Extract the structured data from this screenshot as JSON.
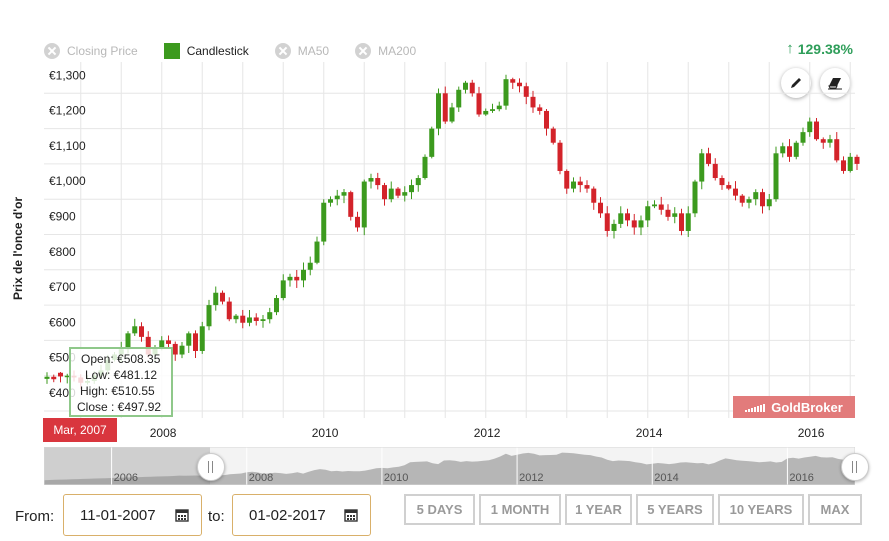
{
  "legend": [
    {
      "label": "Closing Price",
      "state": "off",
      "icon": "x-circle-icon"
    },
    {
      "label": "Candlestick",
      "state": "on",
      "icon": "square-icon",
      "color": "#3c9a1e"
    },
    {
      "label": "MA50",
      "state": "off",
      "icon": "x-circle-icon"
    },
    {
      "label": "MA200",
      "state": "off",
      "icon": "x-circle-icon"
    }
  ],
  "performance": {
    "arrow": "↑",
    "value": "129.38%",
    "color": "#2f9e5a"
  },
  "tools": {
    "draw": "pencil-icon",
    "erase": "eraser-icon"
  },
  "tooltip": {
    "open": "Open: €508.35",
    "low": "Low: €481.12",
    "high": "High: €510.55",
    "close": "Close : €497.92"
  },
  "date_flag": "Mar, 2007",
  "brand": "GoldBroker",
  "controls": {
    "from_label": "From:",
    "from_value": "11-01-2007",
    "to_label": "to:",
    "to_value": "01-02-2017",
    "ranges": [
      "5 DAYS",
      "1 MONTH",
      "1 YEAR",
      "5 YEARS",
      "10 YEARS",
      "MAX"
    ]
  },
  "colors": {
    "up": "#3c9a1e",
    "down": "#d3232a",
    "grid": "#e6e6e6"
  },
  "chart_data": {
    "type": "candlestick",
    "title": "",
    "xlabel": "",
    "ylabel": "Prix de l'once d'or",
    "ylim": [
      400,
      1380
    ],
    "yticks": [
      400,
      500,
      600,
      700,
      800,
      900,
      1000,
      1100,
      1200,
      1300
    ],
    "ytick_labels": [
      "€400",
      "€500",
      "€600",
      "€700",
      "€800",
      "€900",
      "€1,000",
      "€1,100",
      "€1,200",
      "€1,300"
    ],
    "xticks": [
      "2008",
      "2010",
      "2012",
      "2014",
      "2016"
    ],
    "navigator_ticks": [
      "2006",
      "2008",
      "2010",
      "2012",
      "2014",
      "2016"
    ],
    "start": "2007-01",
    "closes": [
      497,
      490,
      498,
      500,
      495,
      480,
      485,
      500,
      515,
      545,
      560,
      575,
      620,
      640,
      610,
      560,
      580,
      600,
      590,
      560,
      585,
      620,
      570,
      640,
      700,
      735,
      710,
      660,
      670,
      650,
      665,
      655,
      660,
      680,
      720,
      770,
      780,
      770,
      800,
      820,
      880,
      990,
      1000,
      1010,
      1020,
      950,
      920,
      1050,
      1060,
      1040,
      1000,
      1030,
      1010,
      1020,
      1040,
      1060,
      1120,
      1200,
      1300,
      1220,
      1260,
      1310,
      1330,
      1300,
      1240,
      1250,
      1255,
      1265,
      1340,
      1330,
      1320,
      1290,
      1260,
      1250,
      1200,
      1160,
      1080,
      1030,
      1050,
      1040,
      1030,
      990,
      960,
      910,
      930,
      960,
      940,
      920,
      940,
      980,
      985,
      970,
      950,
      960,
      910,
      960,
      1050,
      1130,
      1100,
      1060,
      1040,
      1030,
      1010,
      990,
      1000,
      1020,
      980,
      1000,
      1130,
      1150,
      1120,
      1160,
      1190,
      1220,
      1170,
      1160,
      1170,
      1110,
      1080,
      1120,
      1100
    ],
    "tooltip_month": "2007-03",
    "tooltip_ohlc": {
      "open": 508.35,
      "high": 510.55,
      "low": 481.12,
      "close": 497.92
    }
  }
}
